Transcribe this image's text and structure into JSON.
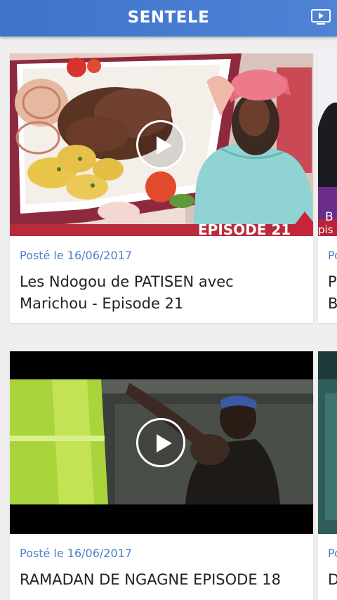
{
  "appbar": {
    "title": "SENTELE",
    "tv_icon": "tv-play-icon"
  },
  "colors": {
    "appbar": "#4a7ed2",
    "date_text": "#4b7fc8",
    "title_text": "#222222",
    "background": "#efefef"
  },
  "rows": [
    {
      "main": {
        "date": "Posté le 16/06/2017",
        "title": "Les Ndogou de PATISEN avec Marichou - Episode 21",
        "thumb_caption": "EPISODE 21"
      },
      "peek": {
        "date": "Po",
        "title_line1": "P",
        "title_line2": "B",
        "thumb_text": "B",
        "thumb_text2": "pis"
      }
    },
    {
      "main": {
        "date": "Posté le 16/06/2017",
        "title": "RAMADAN DE NGAGNE EPISODE 18"
      },
      "peek": {
        "date": "Po",
        "title_line1": "D"
      }
    }
  ]
}
